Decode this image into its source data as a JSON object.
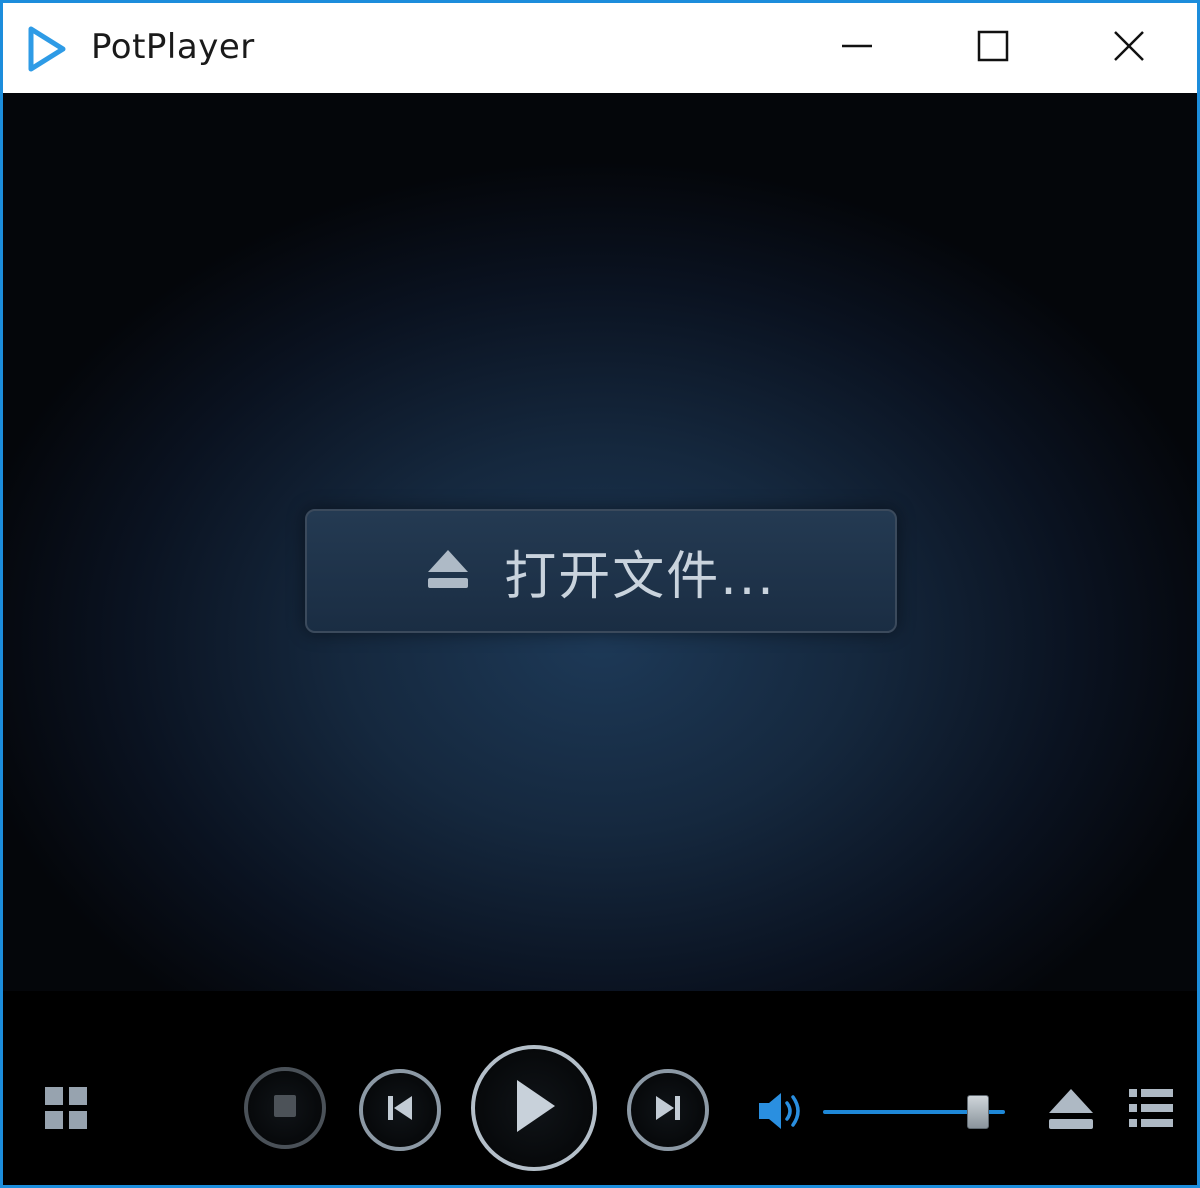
{
  "window": {
    "title": "PotPlayer",
    "accent_color": "#1c8ddc",
    "icons": {
      "app": "play-triangle-icon",
      "minimize": "minimize-icon",
      "maximize": "maximize-icon",
      "close": "close-icon"
    }
  },
  "video_area": {
    "open_file_label": "打开文件...",
    "open_file_icon": "eject-icon"
  },
  "controls": {
    "icons": {
      "grid": "grid-icon",
      "stop": "stop-icon",
      "previous": "previous-track-icon",
      "play": "play-icon",
      "next": "next-track-icon",
      "volume": "volume-speaker-icon",
      "eject": "eject-icon",
      "playlist": "playlist-icon"
    },
    "volume_level": 0.9,
    "volume_color": "#1e88d8"
  }
}
